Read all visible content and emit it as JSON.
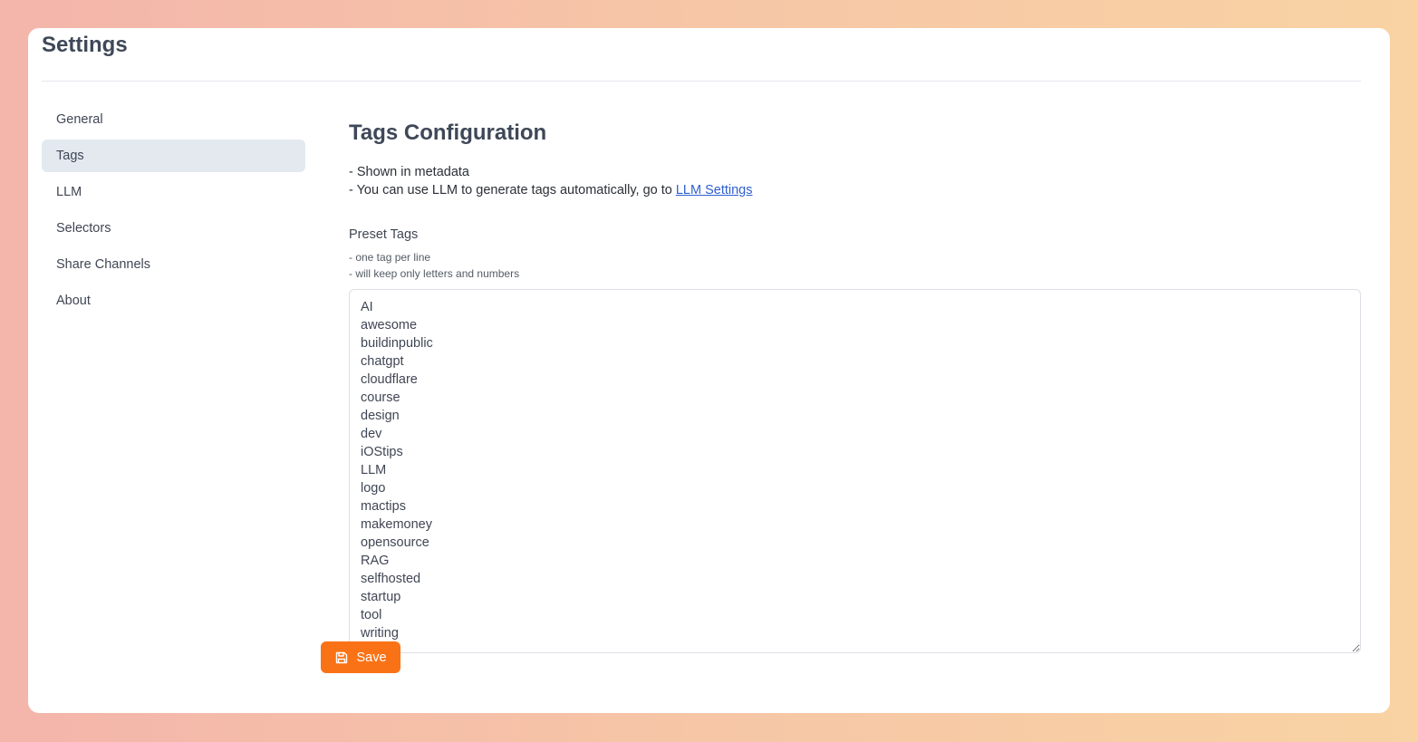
{
  "header": {
    "title": "Settings"
  },
  "sidebar": {
    "items": [
      {
        "label": "General",
        "active": false
      },
      {
        "label": "Tags",
        "active": true
      },
      {
        "label": "LLM",
        "active": false
      },
      {
        "label": "Selectors",
        "active": false
      },
      {
        "label": "Share Channels",
        "active": false
      },
      {
        "label": "About",
        "active": false
      }
    ]
  },
  "main": {
    "title": "Tags Configuration",
    "desc_line1": "- Shown in metadata",
    "desc_line2_prefix": "- You can use LLM to generate tags automatically, go to ",
    "desc_link": "LLM Settings",
    "preset_label": "Preset Tags",
    "hint_line1": "- one tag per line",
    "hint_line2": "- will keep only letters and numbers",
    "tags_value": "AI\nawesome\nbuildinpublic\nchatgpt\ncloudflare\ncourse\ndesign\ndev\niOStips\nLLM\nlogo\nmactips\nmakemoney\nopensource\nRAG\nselfhosted\nstartup\ntool\nwriting",
    "save_label": "Save",
    "save_icon": "floppy-disk-icon"
  },
  "colors": {
    "accent": "#f97316",
    "link": "#2f5fd0",
    "active_nav_bg": "#e4e9f0"
  }
}
